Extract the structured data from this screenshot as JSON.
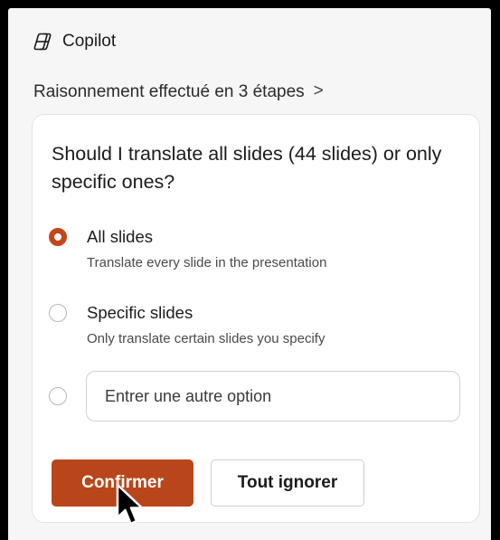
{
  "header": {
    "app_title": "Copilot",
    "icon": "copilot-icon"
  },
  "reasoning": {
    "label": "Raisonnement effectué en 3 étapes",
    "chevron": ">"
  },
  "card": {
    "question": "Should I translate all slides (44 slides) or only specific ones?",
    "options": [
      {
        "title": "All slides",
        "description": "Translate every slide in the presentation",
        "selected": true
      },
      {
        "title": "Specific slides",
        "description": "Only translate certain slides you specify",
        "selected": false
      }
    ],
    "other_option": {
      "placeholder": "Entrer une autre option",
      "value": ""
    },
    "confirm_label": "Confirmer",
    "dismiss_label": "Tout ignorer"
  },
  "colors": {
    "accent": "#b9461a",
    "radio_selected": "#c4461b",
    "panel_bg": "#f6f6f6",
    "frame": "#000000"
  }
}
